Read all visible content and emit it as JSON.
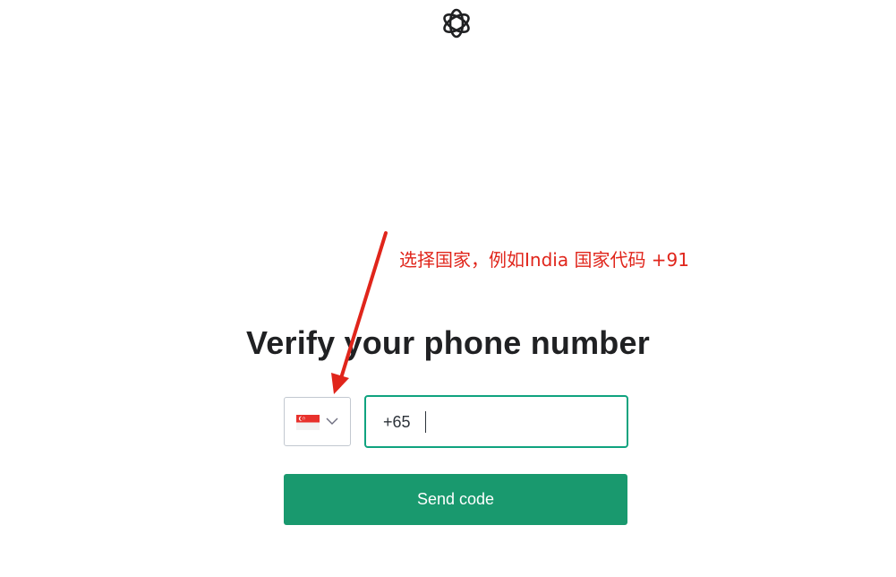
{
  "logo": {
    "icon": "openai-logo-icon"
  },
  "annotation": {
    "text": "选择国家，例如India 国家代码 +91",
    "color": "#e0251b"
  },
  "title": "Verify your phone number",
  "country_select": {
    "flag_icon": "singapore-flag-icon",
    "chevron_icon": "chevron-down-icon"
  },
  "phone_input": {
    "value": "+65"
  },
  "send_button": {
    "label": "Send code"
  },
  "colors": {
    "accent": "#10a37f",
    "button": "#19996e",
    "annotation": "#e0251b"
  }
}
